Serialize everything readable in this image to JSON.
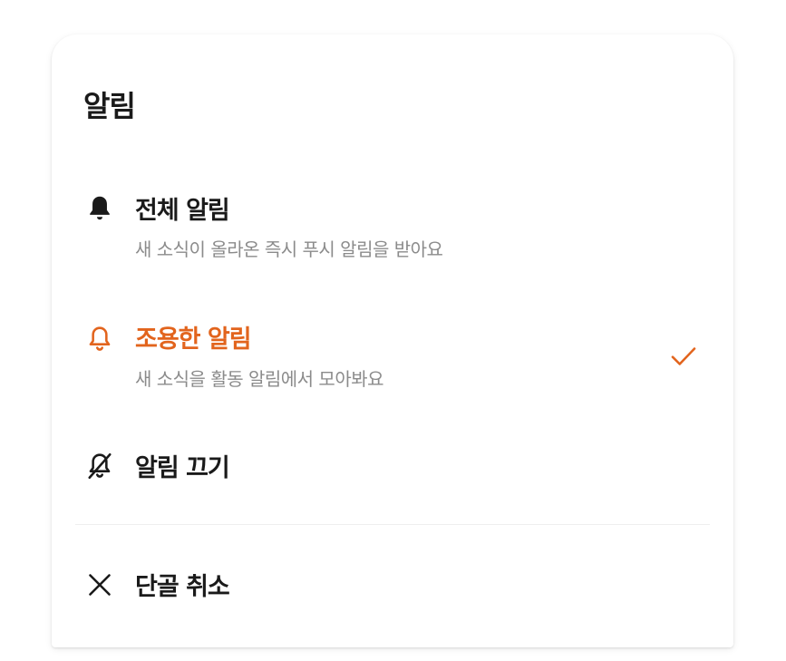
{
  "sheet": {
    "title": "알림",
    "accent_color": "#e2641d",
    "options": [
      {
        "label": "전체 알림",
        "description": "새 소식이 올라온 즉시 푸시 알림을 받아요",
        "icon": "bell-filled-icon",
        "selected": false
      },
      {
        "label": "조용한 알림",
        "description": "새 소식을 활동 알림에서 모아봐요",
        "icon": "bell-outline-icon",
        "selected": true
      },
      {
        "label": "알림 끄기",
        "icon": "bell-off-icon",
        "selected": false
      }
    ],
    "unfavorite": {
      "label": "단골 취소",
      "icon": "close-icon"
    }
  }
}
